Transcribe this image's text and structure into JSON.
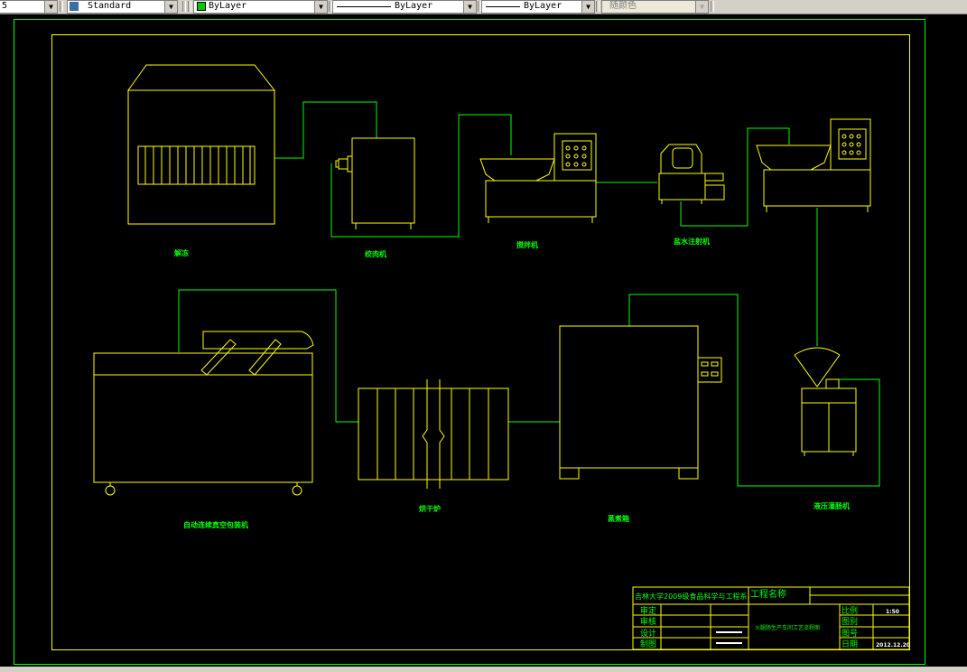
{
  "toolbar": {
    "layer_fragment": "5",
    "text_style": "Standard",
    "color_layer": "ByLayer",
    "linetype": "ByLayer",
    "lineweight": "ByLayer",
    "plot_style": "随颜色"
  },
  "colors": {
    "frame": "#00ff00",
    "equipment": "#ffff00",
    "pipe": "#00ff00",
    "labels": "#00ff00",
    "background": "#000000"
  },
  "equipment_labels": {
    "thaw": "解冻",
    "grinder": "绞肉机",
    "mixer": "搅拌机",
    "brine_injector": "盐水注射机",
    "chopper": "",
    "stuffer": "液压灌肠机",
    "oven": "蒸煮箱",
    "dryer": "烘干炉",
    "packer": "自动连续真空包装机"
  },
  "title_block": {
    "school": "吉林大学2009级食品科学与工程系",
    "project_name_label": "工程名称",
    "approved_label": "审定",
    "checked_label": "审核",
    "designed_label": "设计",
    "drawn_label": "制图",
    "drawing_title": "火腿肠生产车间工艺流程图",
    "scale_label": "比例",
    "scale_value": "1:50",
    "sheet_label": "图别",
    "number_label": "图号",
    "date_label": "日期",
    "date_value": "2012.12.20"
  }
}
